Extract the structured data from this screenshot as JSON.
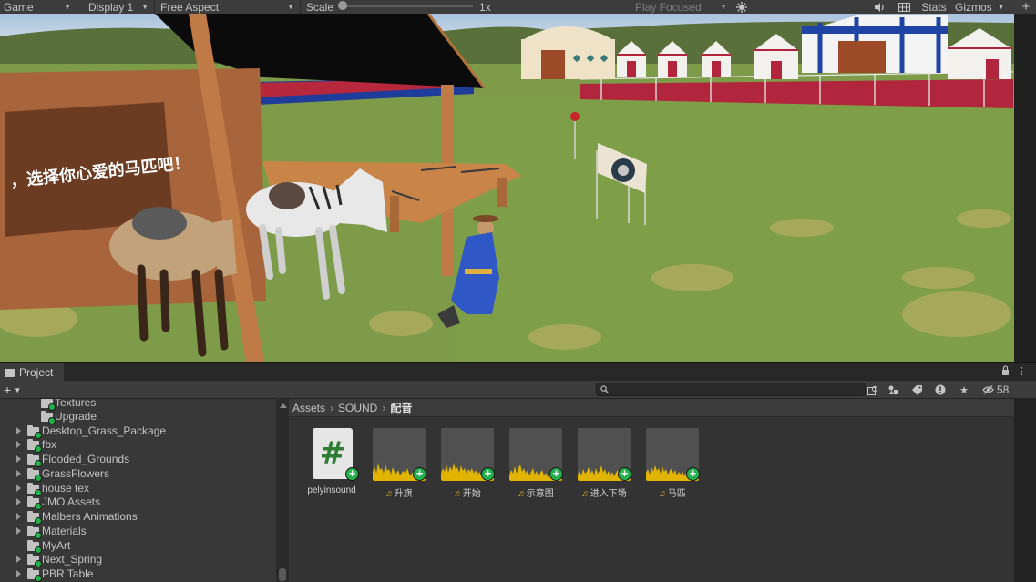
{
  "game_toolbar": {
    "view_label": "Game",
    "display_label": "Display 1",
    "aspect_label": "Free Aspect",
    "scale_label": "Scale",
    "scale_value": "1x",
    "play_mode_label": "Play Focused",
    "stats_label": "Stats",
    "gizmos_label": "Gizmos",
    "icons": [
      "settings-icon",
      "audio-icon",
      "grid-icon",
      "add-icon"
    ]
  },
  "scene": {
    "sign_text": "，选择你心爱的马匹吧！"
  },
  "project": {
    "tab_label": "Project",
    "add_label": "+",
    "search_placeholder": "",
    "hidden_packages_count": "58",
    "tree": [
      {
        "label": "Textures",
        "expandable": false
      },
      {
        "label": "Upgrade",
        "expandable": false
      },
      {
        "label": "Desktop_Grass_Package",
        "expandable": true
      },
      {
        "label": "fbx",
        "expandable": true
      },
      {
        "label": "Flooded_Grounds",
        "expandable": true
      },
      {
        "label": "GrassFlowers",
        "expandable": true
      },
      {
        "label": "house tex",
        "expandable": true
      },
      {
        "label": "JMO Assets",
        "expandable": true
      },
      {
        "label": "Malbers Animations",
        "expandable": true
      },
      {
        "label": "Materials",
        "expandable": true
      },
      {
        "label": "MyArt",
        "expandable": false
      },
      {
        "label": "Next_Spring",
        "expandable": true
      },
      {
        "label": "PBR Table",
        "expandable": true
      }
    ],
    "breadcrumb": [
      "Assets",
      "SOUND",
      "配音"
    ],
    "assets": [
      {
        "name": "pelyinsound",
        "type": "script"
      },
      {
        "name": "升旗",
        "type": "audio"
      },
      {
        "name": "开始",
        "type": "audio"
      },
      {
        "name": "示意图",
        "type": "audio"
      },
      {
        "name": "进入下场",
        "type": "audio"
      },
      {
        "name": "马匹",
        "type": "audio"
      }
    ]
  },
  "colors": {
    "accent_green": "#23b14d",
    "waveform_yellow": "#e0b400",
    "panel_bg": "#383838",
    "toolbar_bg": "#3c3c3c"
  }
}
